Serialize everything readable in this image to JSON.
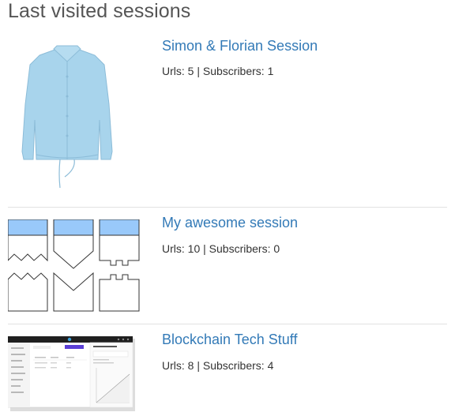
{
  "page": {
    "title": "Last visited sessions"
  },
  "sessions": [
    {
      "title": "Simon & Florian Session",
      "urls": "Urls: 5",
      "separator": "|",
      "subscribers": "Subscribers: 1",
      "thumbnail": "light-blue-jacket-image"
    },
    {
      "title": "My awesome session",
      "urls": "Urls: 10",
      "separator": "|",
      "subscribers": "Subscribers: 0",
      "thumbnail": "paper-cut-shapes-diagram"
    },
    {
      "title": "Blockchain Tech Stuff",
      "urls": "Urls: 8",
      "separator": "|",
      "subscribers": "Subscribers: 4",
      "thumbnail": "dashboard-screenshot"
    }
  ],
  "colors": {
    "link": "#337ab7",
    "shape_fill": "#99c9fa",
    "jacket": "#a8d4ec"
  }
}
